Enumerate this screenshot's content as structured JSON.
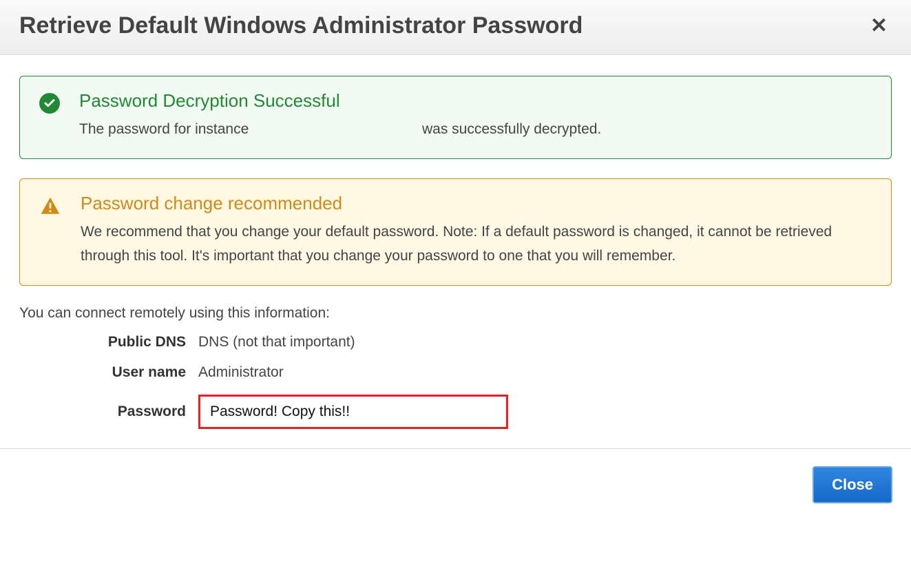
{
  "header": {
    "title": "Retrieve Default Windows Administrator Password"
  },
  "alerts": {
    "success": {
      "title": "Password Decryption Successful",
      "text_before": "The password for instance",
      "text_after": "was successfully decrypted."
    },
    "warning": {
      "title": "Password change recommended",
      "text": "We recommend that you change your default password. Note: If a default password is changed, it cannot be retrieved through this tool. It's important that you change your password to one that you will remember."
    }
  },
  "connect": {
    "intro": "You can connect remotely using this information:",
    "labels": {
      "public_dns": "Public DNS",
      "user_name": "User name",
      "password": "Password"
    },
    "values": {
      "public_dns": "DNS (not that important)",
      "user_name": "Administrator",
      "password": "Password! Copy this!!"
    }
  },
  "footer": {
    "close_label": "Close"
  }
}
